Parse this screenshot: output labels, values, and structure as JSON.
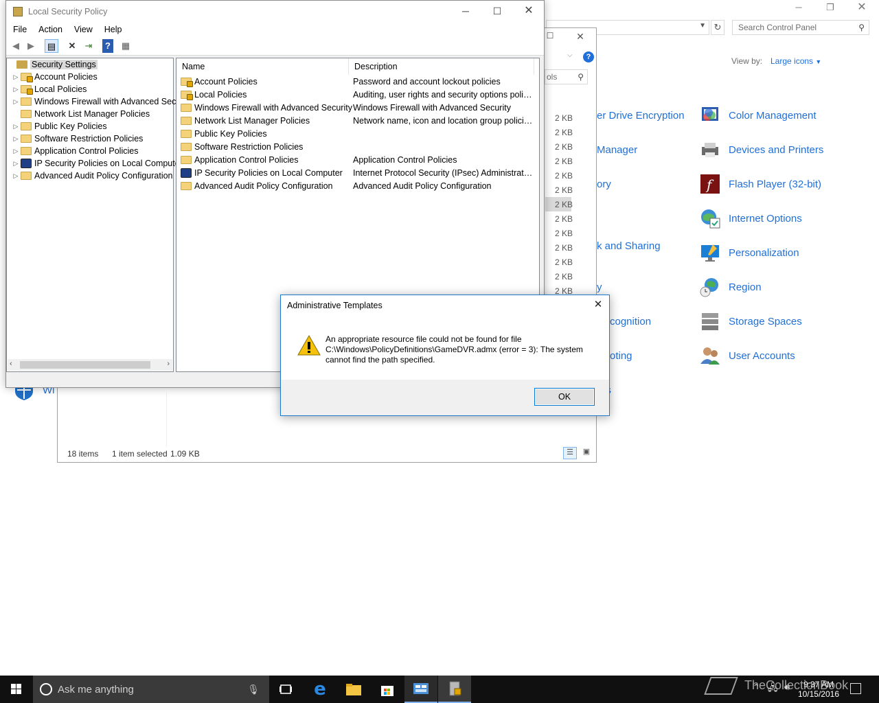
{
  "control_panel": {
    "search_placeholder": "Search Control Panel",
    "view_by_label": "View by:",
    "view_by_value": "Large icons",
    "items_right": [
      {
        "label": "Color Management",
        "icon": "color-management-icon"
      },
      {
        "label": "Devices and Printers",
        "icon": "devices-printers-icon"
      },
      {
        "label": "Flash Player (32-bit)",
        "icon": "flash-player-icon"
      },
      {
        "label": "Internet Options",
        "icon": "internet-options-icon"
      },
      {
        "label": "Personalization",
        "icon": "personalization-icon"
      },
      {
        "label": "Region",
        "icon": "region-icon"
      },
      {
        "label": "Storage Spaces",
        "icon": "storage-spaces-icon"
      },
      {
        "label": "User Accounts",
        "icon": "user-accounts-icon"
      }
    ],
    "items_middle_partial": [
      "er Drive Encryption",
      "Manager",
      "ory",
      "k and Sharing",
      "y",
      "cognition",
      "oting",
      "ers"
    ],
    "bottom_left_partial": "Wi"
  },
  "explorer": {
    "search_partial": "ols",
    "sizes": [
      "2 KB",
      "2 KB",
      "2 KB",
      "2 KB",
      "2 KB",
      "2 KB",
      "2 KB",
      "2 KB",
      "2 KB",
      "2 KB",
      "2 KB",
      "2 KB",
      "2 KB"
    ],
    "status": {
      "count": "18 items",
      "selected": "1 item selected",
      "size": "1.09 KB"
    }
  },
  "lsp": {
    "title": "Local Security Policy",
    "menu": [
      "File",
      "Action",
      "View",
      "Help"
    ],
    "tree_root": "Security Settings",
    "tree_items": [
      "Account Policies",
      "Local Policies",
      "Windows Firewall with Advanced Secu",
      "Network List Manager Policies",
      "Public Key Policies",
      "Software Restriction Policies",
      "Application Control Policies",
      "IP Security Policies on Local Compute",
      "Advanced Audit Policy Configuration"
    ],
    "columns": {
      "name": "Name",
      "description": "Description"
    },
    "rows": [
      {
        "name": "Account Policies",
        "description": "Password and account lockout policies"
      },
      {
        "name": "Local Policies",
        "description": "Auditing, user rights and security options polici..."
      },
      {
        "name": "Windows Firewall with Advanced Security",
        "description": "Windows Firewall with Advanced Security"
      },
      {
        "name": "Network List Manager Policies",
        "description": "Network name, icon and location group policies."
      },
      {
        "name": "Public Key Policies",
        "description": ""
      },
      {
        "name": "Software Restriction Policies",
        "description": ""
      },
      {
        "name": "Application Control Policies",
        "description": "Application Control Policies"
      },
      {
        "name": "IP Security Policies on Local Computer",
        "description": "Internet Protocol Security (IPsec) Administratio..."
      },
      {
        "name": "Advanced Audit Policy Configuration",
        "description": "Advanced Audit Policy Configuration"
      }
    ]
  },
  "dialog": {
    "title": "Administrative Templates",
    "message_line1": "An appropriate resource file could not be found for file",
    "message_line2": "C:\\Windows\\PolicyDefinitions\\GameDVR.admx (error = 3): The system",
    "message_line3": "cannot find the path specified.",
    "ok_label": "OK"
  },
  "taskbar": {
    "search_placeholder": "Ask me anything",
    "time": "9:37 AM",
    "date": "10/15/2016",
    "watermark": "TheCollectionBook"
  },
  "colors": {
    "link_blue": "#1e6fd9",
    "dialog_border": "#1979ca",
    "taskbar": "#101010"
  }
}
